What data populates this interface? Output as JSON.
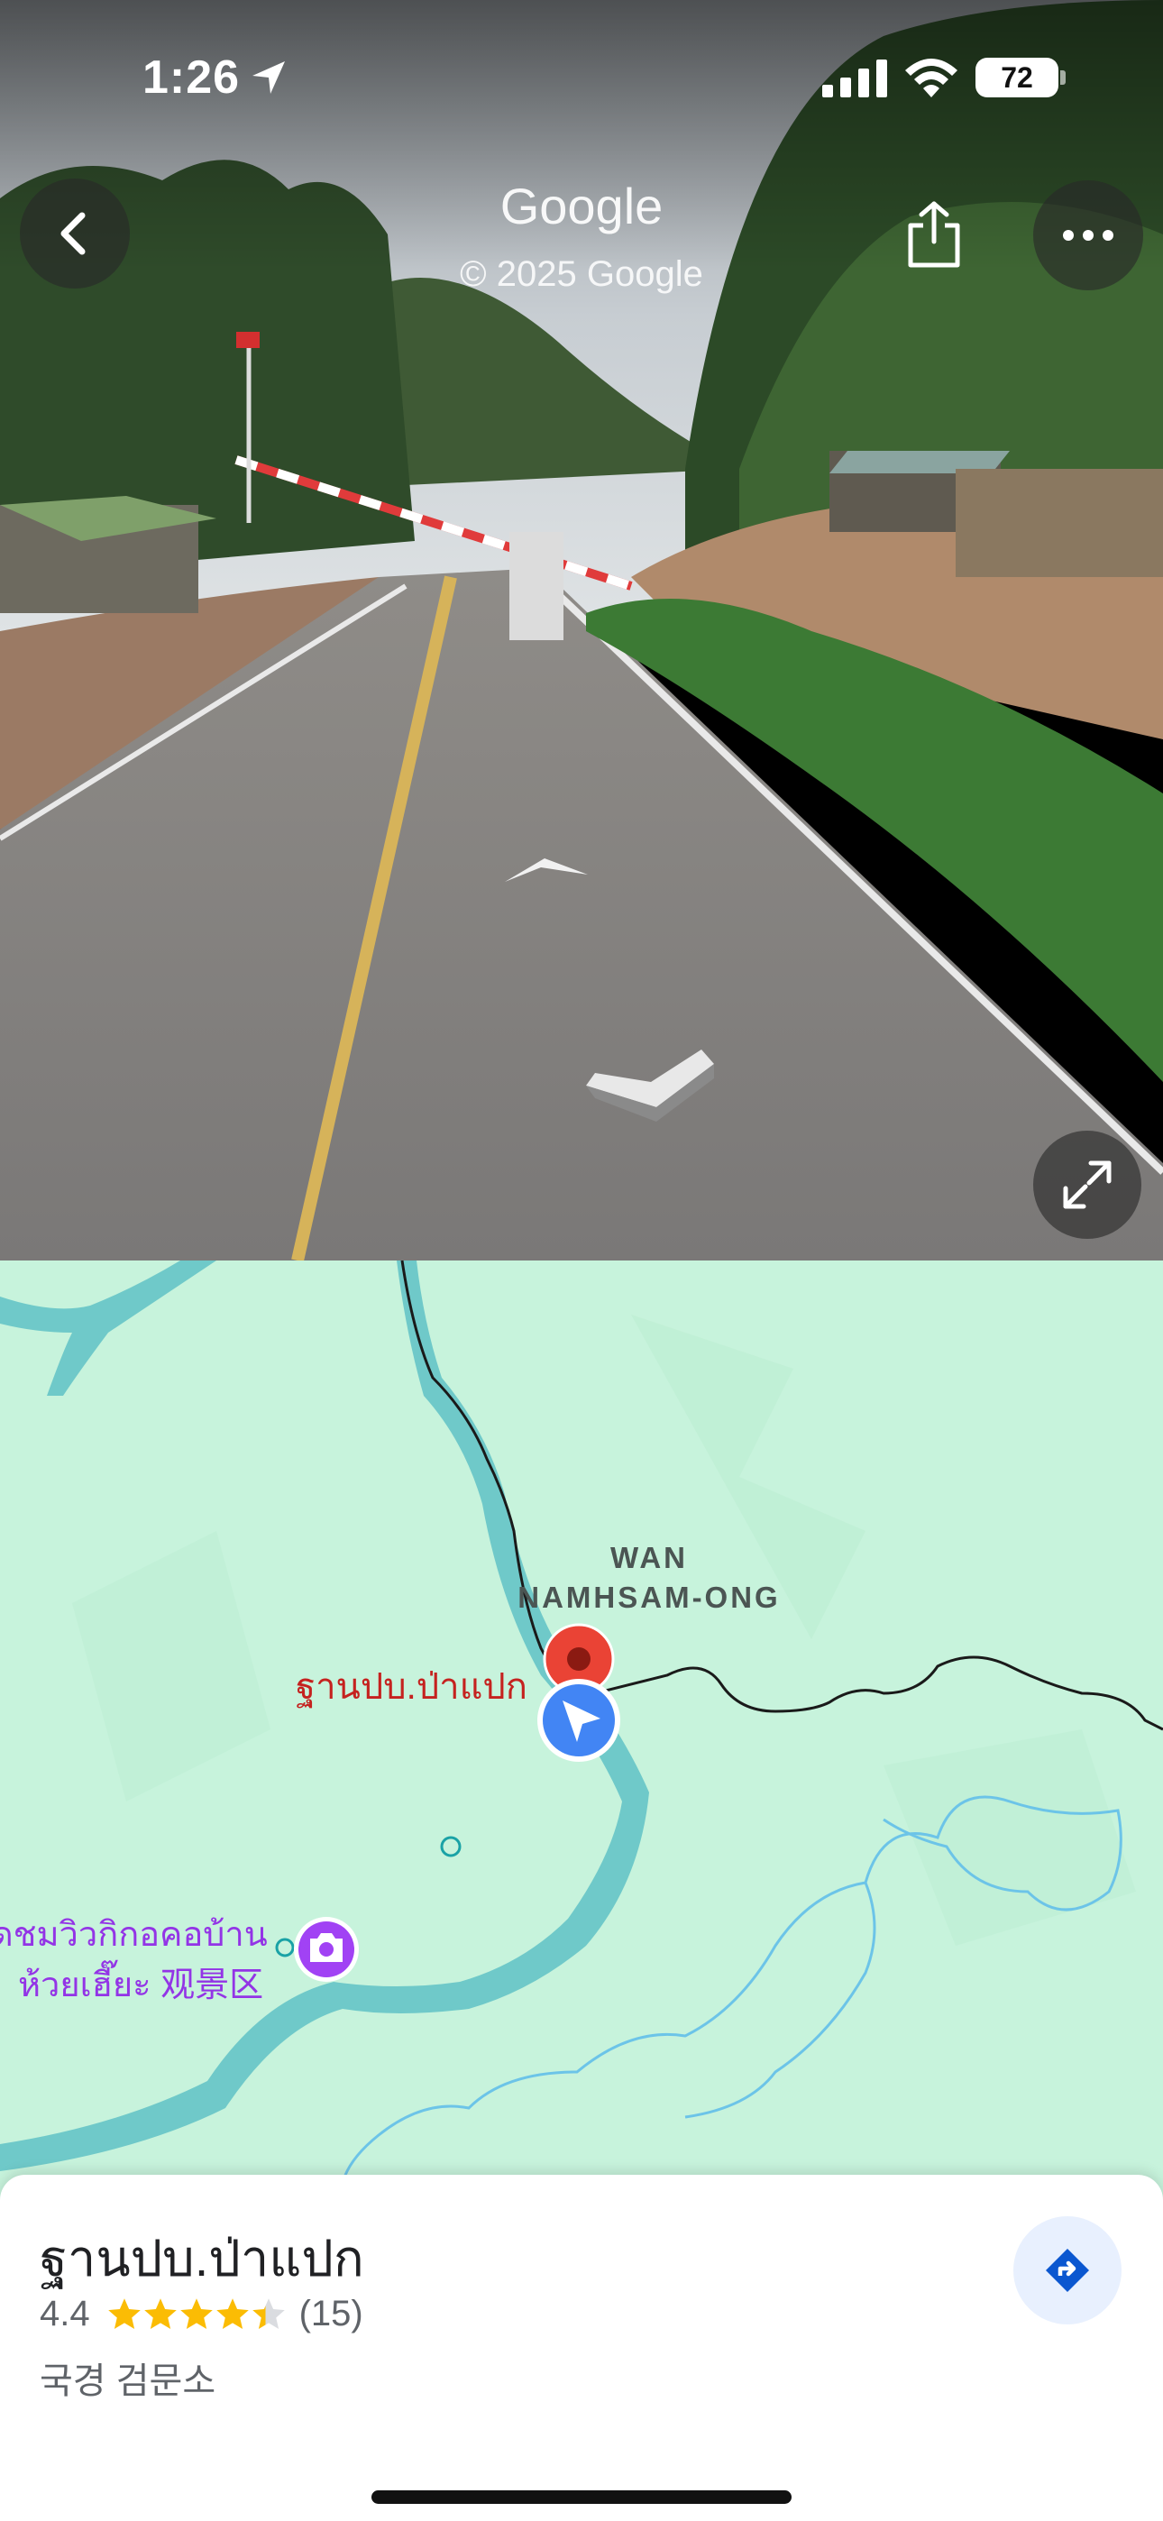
{
  "status_bar": {
    "time": "1:26",
    "battery": "72"
  },
  "street_view": {
    "title": "Google",
    "copyright": "© 2025 Google"
  },
  "map": {
    "labels": {
      "area_line1": "WAN",
      "area_line2": "NAMHSAM-ONG",
      "selected_place": "ฐานปบ.ป่าแปก",
      "viewpoint_line1": "ดชมวิวกิกอคอบ้าน",
      "viewpoint_line2": "ห้วยเฮี๊ยะ 观景区"
    },
    "colors": {
      "land": "#c7f3dc",
      "river": "#6fc9c9",
      "border": "#1a1a1a",
      "pin": "#ea4335",
      "location": "#4285f4",
      "viewpoint": "#a142f4"
    }
  },
  "place": {
    "name": "ฐานปบ.ป่าแปก",
    "rating": "4.4",
    "rating_value": 4.4,
    "review_count": "(15)",
    "category": "국경 검문소"
  },
  "icons": {
    "back": "chevron-left-icon",
    "share": "share-icon",
    "more": "more-horizontal-icon",
    "expand": "expand-icon",
    "directions": "directions-icon",
    "location_arrow": "location-arrow-icon"
  }
}
